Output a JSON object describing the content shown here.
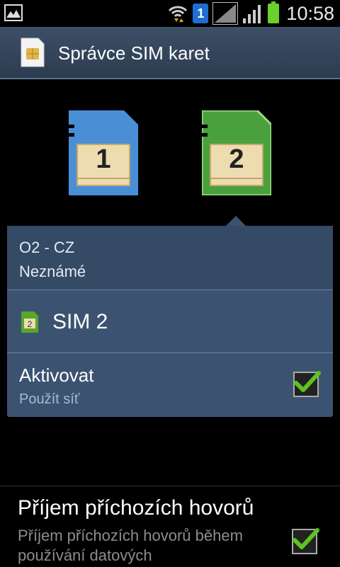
{
  "status_bar": {
    "time": "10:58",
    "sim_badge": "1"
  },
  "header": {
    "title": "Správce SIM karet"
  },
  "sim_cards": [
    {
      "number": "1",
      "color": "#4a8fd6"
    },
    {
      "number": "2",
      "color": "#4aa03c"
    }
  ],
  "panel": {
    "operator": "O2 - CZ",
    "operator_status": "Neznámé",
    "sim_label": "SIM 2",
    "sim_icon_number": "2",
    "activate_title": "Aktivovat",
    "activate_subtitle": "Použít síť",
    "activate_checked": true
  },
  "setting": {
    "title": "Příjem příchozích hovorů",
    "subtitle": "Příjem příchozích hovorů během používání datových",
    "checked": true
  },
  "colors": {
    "accent_check": "#5ec21f",
    "panel_bg": "#3b5370"
  }
}
